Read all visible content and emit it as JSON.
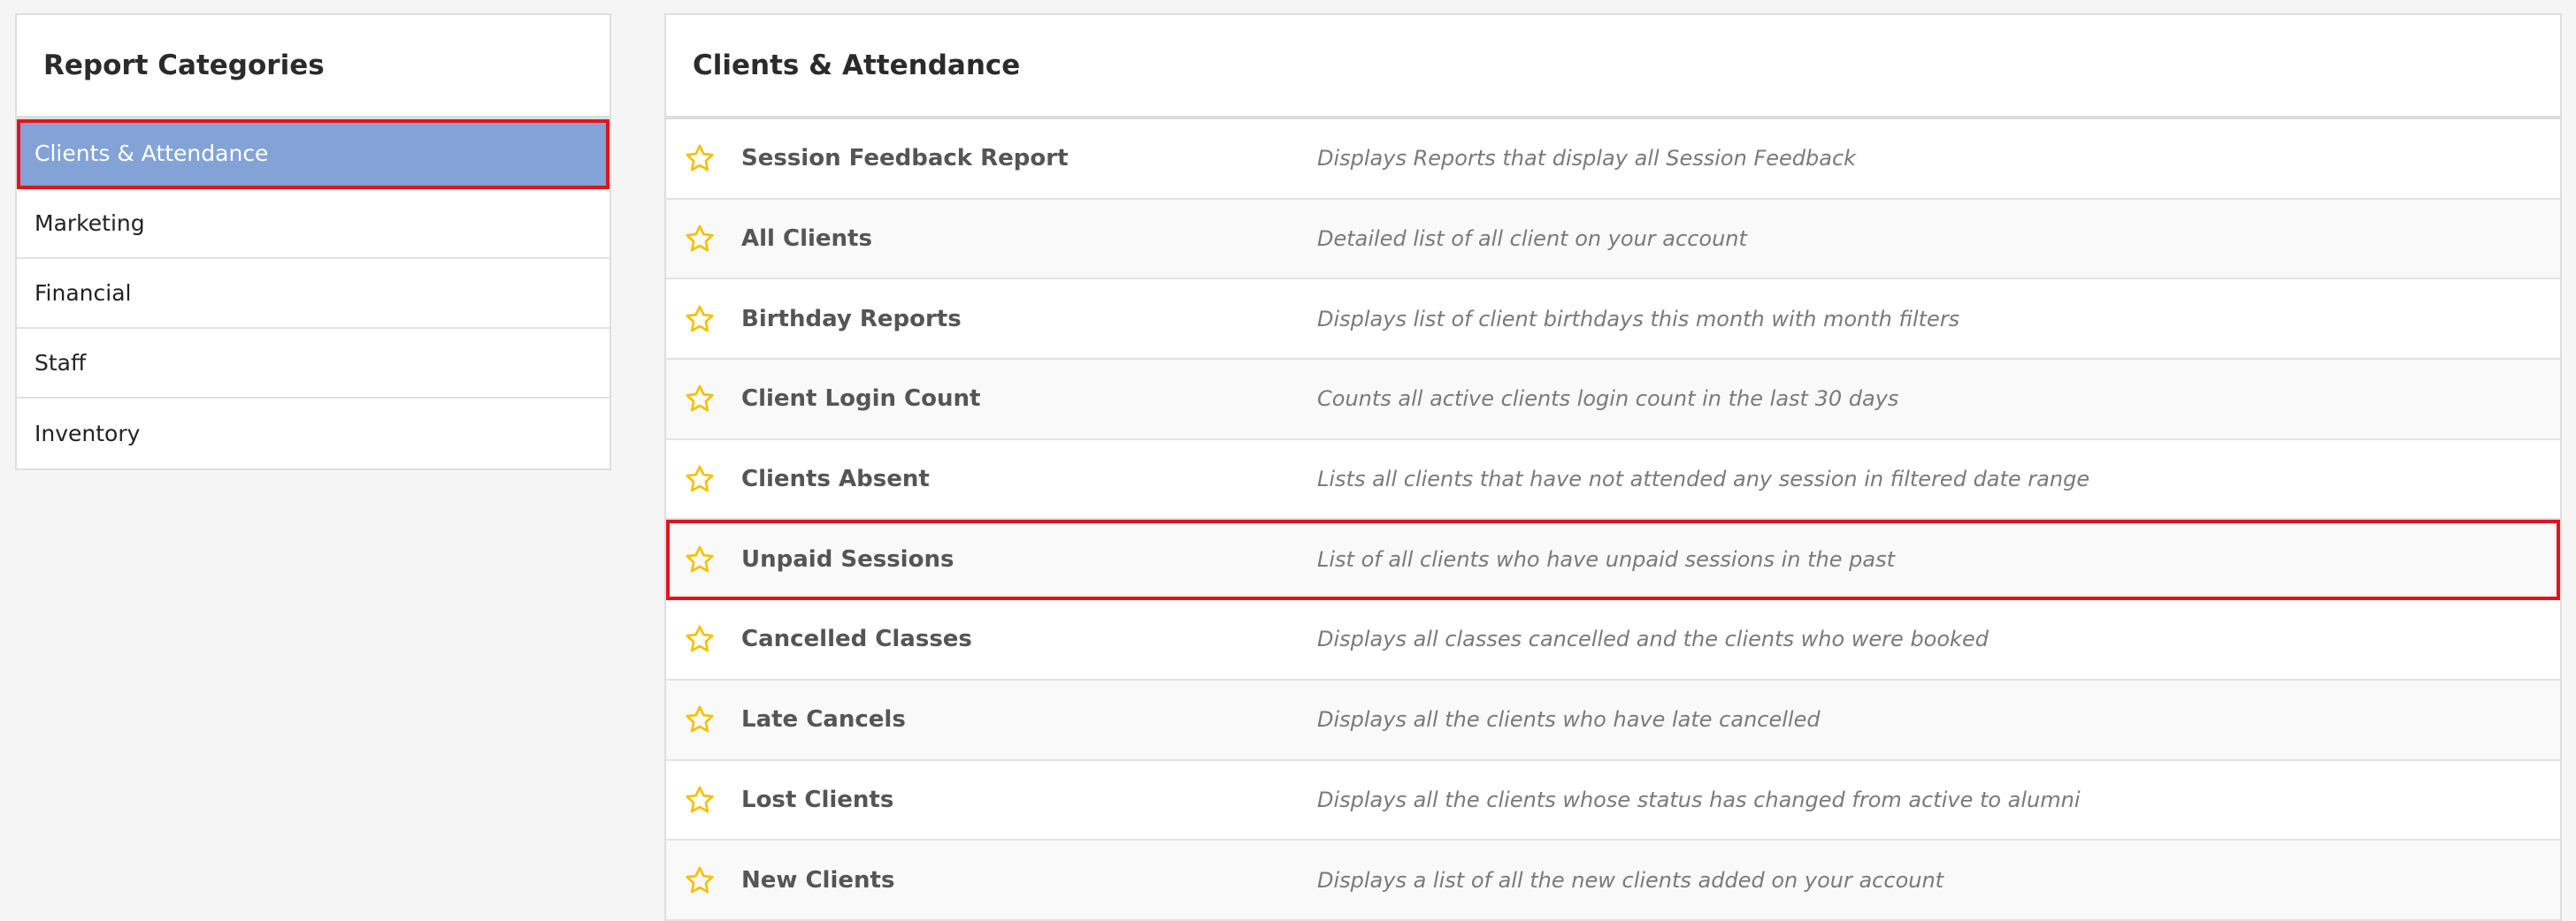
{
  "sidebar": {
    "title": "Report Categories",
    "items": [
      {
        "label": "Clients & Attendance",
        "active": true
      },
      {
        "label": "Marketing",
        "active": false
      },
      {
        "label": "Financial",
        "active": false
      },
      {
        "label": "Staff",
        "active": false
      },
      {
        "label": "Inventory",
        "active": false
      }
    ]
  },
  "main": {
    "title": "Clients & Attendance",
    "star_icon": "star-outline-icon",
    "reports": [
      {
        "name": "Session Feedback Report",
        "description": "Displays Reports that display all Session Feedback"
      },
      {
        "name": "All Clients",
        "description": "Detailed list of all client on your account"
      },
      {
        "name": "Birthday Reports",
        "description": "Displays list of client birthdays this month with month filters"
      },
      {
        "name": "Client Login Count",
        "description": "Counts all active clients login count in the last 30 days"
      },
      {
        "name": "Clients Absent",
        "description": "Lists all clients that have not attended any session in filtered date range"
      },
      {
        "name": "Unpaid Sessions",
        "description": "List of all clients who have unpaid sessions in the past"
      },
      {
        "name": "Cancelled Classes",
        "description": "Displays all classes cancelled and the clients who were booked"
      },
      {
        "name": "Late Cancels",
        "description": "Displays all the clients who have late cancelled"
      },
      {
        "name": "Lost Clients",
        "description": "Displays all the clients whose status has changed from active to alumni"
      },
      {
        "name": "New Clients",
        "description": "Displays a list of all the new clients added on your account"
      }
    ]
  },
  "colors": {
    "active_category_bg": "#83a3d6",
    "highlight_border": "#e0141e",
    "star": "#f2c200"
  }
}
